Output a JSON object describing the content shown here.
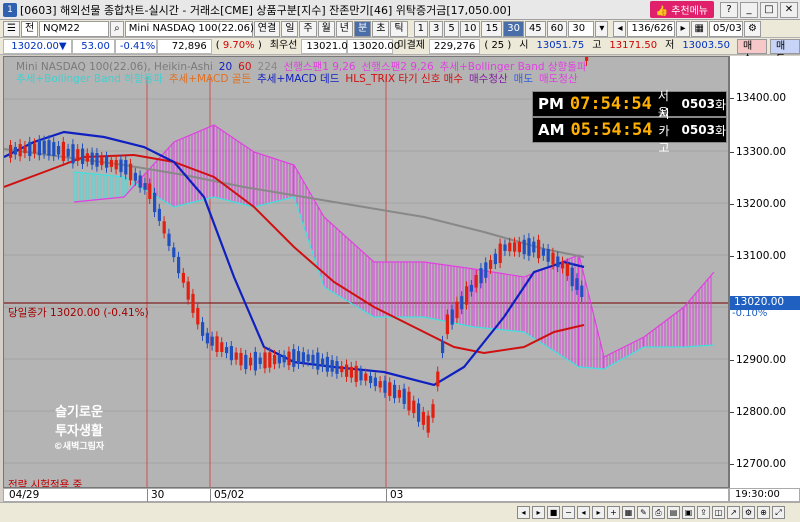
{
  "window": {
    "title": "[0603] 해외선물 종합차트-실시간 - 거래소[CME] 상품구분[지수] 잔존만기[46] 위탁증거금[17,050.00]",
    "recommend_menu": "추천메뉴"
  },
  "toolbar": {
    "side_label": "전",
    "symbol_code": "NQM22",
    "symbol_name": "Mini NASDAQ 100(22.06)",
    "period_buttons": [
      "연결",
      "일",
      "주",
      "월",
      "년",
      "분",
      "초",
      "틱"
    ],
    "selected_period": "분",
    "interval_buttons": [
      "1",
      "3",
      "5",
      "10",
      "15",
      "30",
      "45",
      "60"
    ],
    "selected_interval": "30",
    "interval_value": "30",
    "count": "136/626",
    "date": "05/03"
  },
  "quote": {
    "price": "13020.00",
    "down_arrow": "▼",
    "change": "53.00",
    "change_pct": "-0.41%",
    "volume": "72,896",
    "vol_ratio": "9.70%",
    "best_ask_label": "최우선",
    "best_ask": "13021.00",
    "last": "13020.00",
    "open_interest_label": "미결제",
    "open_interest": "229,276",
    "oi_change": "25",
    "open_label": "시",
    "open": "13051.75",
    "high_label": "고",
    "high": "13171.50",
    "low_label": "저",
    "low": "13003.50",
    "buy": "매수",
    "sell": "매도"
  },
  "legend": {
    "items": [
      {
        "text": "Mini NASDAQ 100(22.06), Heikin-Ashi",
        "color": "#7a7a7a"
      },
      {
        "text": "20",
        "color": "#1020c0"
      },
      {
        "text": "60",
        "color": "#d01010"
      },
      {
        "text": "224",
        "color": "#888888"
      },
      {
        "text": "선행스팬1 9,26",
        "color": "#e040e0"
      },
      {
        "text": "선행스팬2 9,26",
        "color": "#e040e0"
      },
      {
        "text": "추세+Bollinger Band 상향돌파",
        "color": "#e040e0"
      }
    ],
    "items2": [
      {
        "text": "추세+Bollinger Band 하향돌파",
        "color": "#40d0d0"
      },
      {
        "text": "추세+MACD 골든",
        "color": "#e07020"
      },
      {
        "text": "추세+MACD 데드",
        "color": "#1020c0"
      },
      {
        "text": "HLS_TRIX 타기 신호 매수",
        "color": "#d01010"
      },
      {
        "text": "매수청산",
        "color": "#8020a0"
      },
      {
        "text": "매도",
        "color": "#3060e0"
      },
      {
        "text": "매도청산",
        "color": "#e040e0"
      }
    ]
  },
  "clocks": [
    {
      "label": "PM",
      "time": "07:54:54",
      "city": "서  울",
      "code": "0503",
      "day": "화"
    },
    {
      "label": "AM",
      "time": "05:54:54",
      "city": "시카고",
      "code": "0503",
      "day": "화"
    }
  ],
  "prev_close_label": "당일종가 13020.00 (-0.41%)",
  "watermark": {
    "line1": "슬기로운",
    "line2": "투자생활",
    "line3": "©새벽그림자"
  },
  "strategy_label": "전략 시험적용 중",
  "yaxis": {
    "ticks": [
      "13400.00",
      "13300.00",
      "13200.00",
      "13100.00",
      "12900.00",
      "12800.00",
      "12700.00"
    ],
    "current": "13020.00",
    "current_pct": "-0.10%",
    "time_label": "19:30:00"
  },
  "xaxis": {
    "labels": [
      "04/29",
      "30",
      "05/02",
      "03"
    ]
  },
  "colors": {
    "ma20": "#1020c0",
    "ma60": "#d01010",
    "ma224": "#888888",
    "cloud_up": "#e040e0",
    "cloud_down": "#40e0e0",
    "candle_up": "#e02010",
    "candle_down": "#2050c0",
    "chart_bg": "#b4b4b4"
  }
}
